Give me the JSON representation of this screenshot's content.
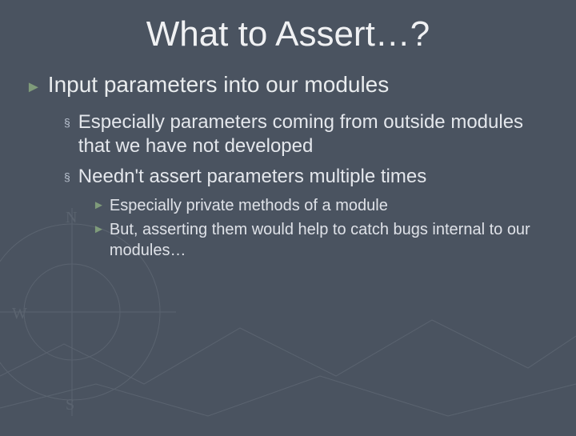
{
  "slide": {
    "title": "What to Assert…?",
    "bullets": [
      {
        "text": "Input parameters into our modules",
        "children": [
          {
            "text": "Especially parameters coming from outside modules that we have not developed",
            "children": []
          },
          {
            "text": "Needn't assert parameters multiple times",
            "children": [
              {
                "text": "Especially private methods of a module"
              },
              {
                "text": "But, asserting them would help to catch bugs internal to our modules…"
              }
            ]
          }
        ]
      }
    ]
  },
  "icons": {
    "triangle": "►",
    "square": "§"
  },
  "colors": {
    "background": "#4a5360",
    "text": "#e8eaee",
    "bullet_triangle": "#7f9b7a",
    "bullet_square": "#b9c2cf"
  }
}
